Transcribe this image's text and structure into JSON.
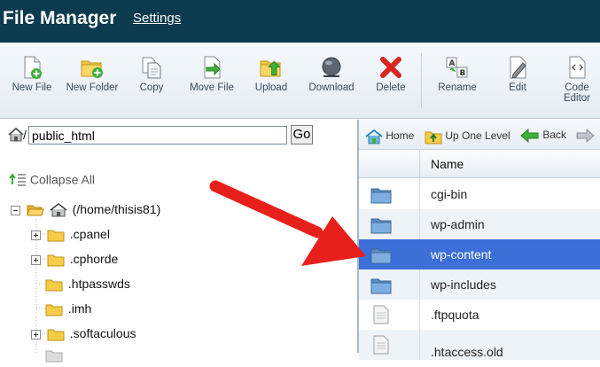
{
  "header": {
    "title": "File Manager",
    "settings_label": "Settings"
  },
  "toolbar": {
    "new_file": "New File",
    "new_folder": "New Folder",
    "copy": "Copy",
    "move_file": "Move File",
    "upload": "Upload",
    "download": "Download",
    "delete": "Delete",
    "rename": "Rename",
    "edit": "Edit",
    "code_editor_line1": "Code",
    "code_editor_line2": "Editor"
  },
  "path": {
    "separator": "/",
    "value": "public_html",
    "go_label": "Go"
  },
  "tree": {
    "collapse_all": "Collapse All",
    "root_label": "(/home/thisis81)",
    "items": [
      ".cpanel",
      ".cphorde",
      ".htpasswds",
      ".imh",
      ".softaculous"
    ]
  },
  "nav": {
    "home": "Home",
    "up_one_level": "Up One Level",
    "back": "Back"
  },
  "table": {
    "name_header": "Name",
    "rows": [
      "cgi-bin",
      "wp-admin",
      "wp-content",
      "wp-includes",
      ".ftpquota",
      ".htaccess.old"
    ]
  },
  "selected_row": "wp-content",
  "colors": {
    "header_bg": "#0c3a4f",
    "selection": "#3d6fd8",
    "arrow": "#e8201c"
  }
}
